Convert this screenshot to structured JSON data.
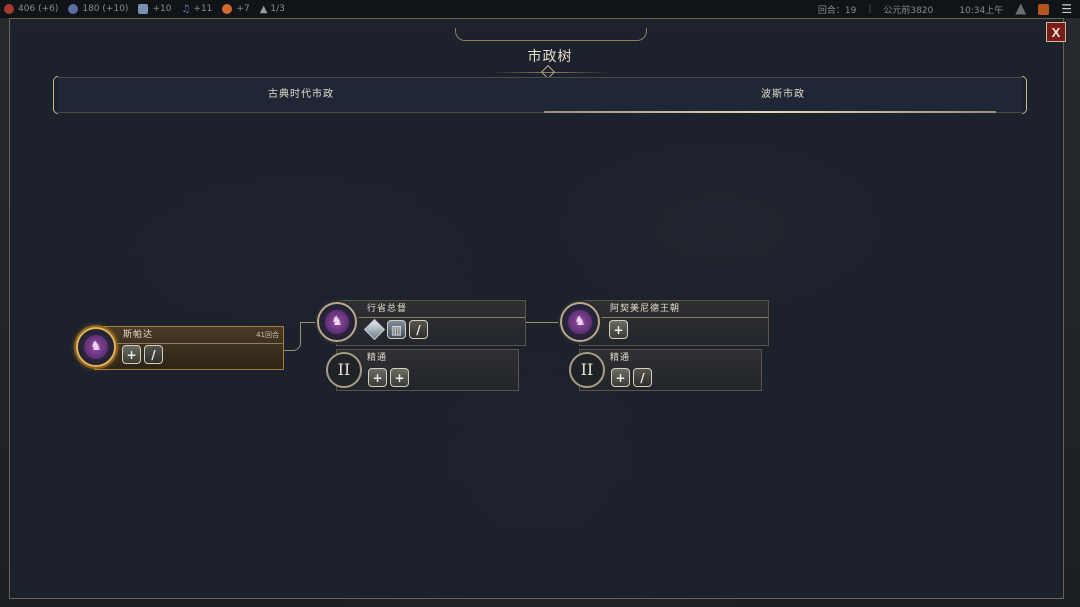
{
  "topbar": {
    "resources": [
      {
        "icon": "science-icon",
        "value": "406",
        "delta": "(+6)",
        "color": "#a33a2a"
      },
      {
        "icon": "culture-icon",
        "value": "180",
        "delta": "(+10)",
        "color": "#5e6aa0"
      },
      {
        "icon": "faith-icon",
        "value": "+10",
        "delta": "",
        "color": "#7b8fb3"
      },
      {
        "icon": "music-icon",
        "value": "+11",
        "delta": "",
        "color": "#6a7fc0"
      },
      {
        "icon": "happiness-icon",
        "value": "+7",
        "delta": "",
        "color": "#d06a2a"
      },
      {
        "icon": "settlement-icon",
        "value": "1/3",
        "delta": "",
        "color": "#8a8a8a"
      }
    ],
    "turn": "回合：19",
    "year": "公元前3820",
    "time": "10:34上午"
  },
  "header": {
    "title": "市政树",
    "close_label": "X"
  },
  "tabs": [
    {
      "label": "古典时代市政",
      "active": false
    },
    {
      "label": "波斯市政",
      "active": true
    }
  ],
  "nodes": {
    "sparta": {
      "name": "斯帕达",
      "turns": "41回合",
      "icon": "horseman-icon"
    },
    "governor": {
      "name": "行省总督",
      "icon": "horseman-icon"
    },
    "governor_mastery": {
      "name": "精通",
      "roman": "II"
    },
    "achaemenid": {
      "name": "阿契美尼德王朝",
      "icon": "horseman-icon"
    },
    "achaemenid_mastery": {
      "name": "精通",
      "roman": "II"
    }
  },
  "colors": {
    "accent_gold": "#c9b995",
    "close_red": "#7a1d1a",
    "selected_glow": "#e0b356"
  }
}
